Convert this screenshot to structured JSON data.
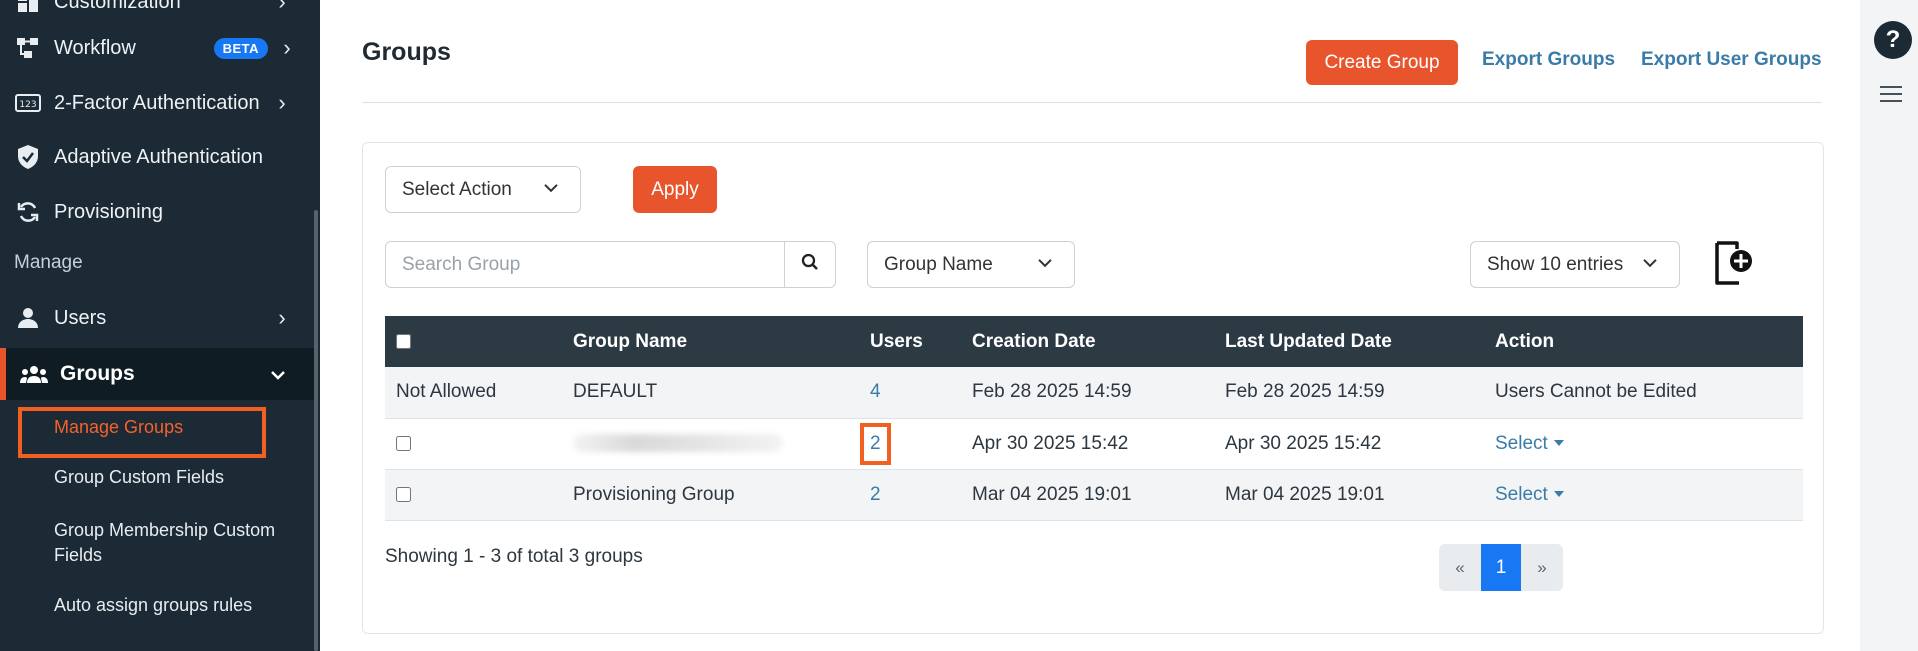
{
  "sidebar": {
    "items": [
      {
        "label": "Customization",
        "icon": "dashboard-icon"
      },
      {
        "label": "Workflow",
        "badge": "BETA",
        "icon": "workflow-icon"
      },
      {
        "label": "2-Factor Authentication",
        "icon": "123-icon"
      },
      {
        "label": "Adaptive Authentication",
        "icon": "shield-check-icon"
      },
      {
        "label": "Provisioning",
        "icon": "sync-icon"
      }
    ],
    "section_manage": "Manage",
    "users_label": "Users",
    "groups_label": "Groups",
    "sub_items": [
      "Manage Groups",
      "Group Custom Fields",
      "Group Membership Custom Fields",
      "Auto assign groups rules"
    ]
  },
  "header": {
    "title": "Groups",
    "create_label": "Create Group",
    "export_groups_label": "Export Groups",
    "export_user_groups_label": "Export User Groups"
  },
  "filters": {
    "action_select": "Select Action",
    "apply_label": "Apply",
    "search_placeholder": "Search Group",
    "column_select": "Group Name",
    "entries_select": "Show 10 entries"
  },
  "table": {
    "columns": [
      "Group Name",
      "Users",
      "Creation Date",
      "Last Updated Date",
      "Action"
    ],
    "rows": [
      {
        "checkbox_text": "Not Allowed",
        "name": "DEFAULT",
        "users": "4",
        "created": "Feb 28 2025 14:59",
        "updated": "Feb 28 2025 14:59",
        "action": "Users Cannot be Edited"
      },
      {
        "name": "",
        "users": "2",
        "created": "Apr 30 2025 15:42",
        "updated": "Apr 30 2025 15:42",
        "action": "Select"
      },
      {
        "name": "Provisioning Group",
        "users": "2",
        "created": "Mar 04 2025 19:01",
        "updated": "Mar 04 2025 19:01",
        "action": "Select"
      }
    ]
  },
  "footer": {
    "showing_text": "Showing 1 - 3 of total 3 groups",
    "pager_prev": "«",
    "pager_current": "1",
    "pager_next": "»"
  },
  "rail": {
    "help_label": "?"
  },
  "colors": {
    "accent": "#e8552c",
    "link": "#3a7ca8",
    "sidebar_bg": "#1b2a34",
    "header_bg": "#2c3a44",
    "pager_active": "#1877f2"
  }
}
